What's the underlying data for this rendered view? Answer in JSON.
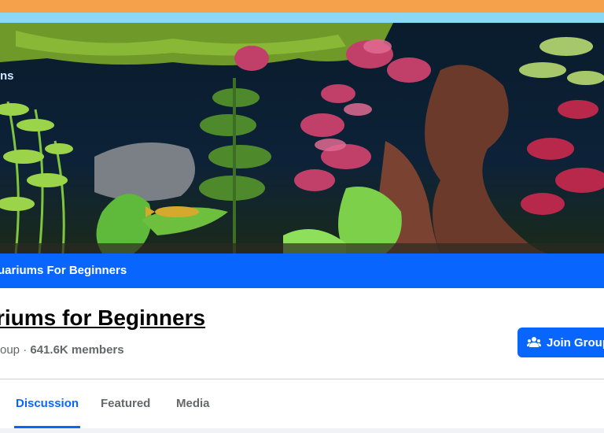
{
  "cover": {
    "logo_text": "ns"
  },
  "banner": {
    "group_name": "uariums For Beginners"
  },
  "group": {
    "title": "riums for Beginners",
    "privacy": "roup",
    "separator": " · ",
    "members": "641.6K members"
  },
  "join_button": {
    "label": "Join Group",
    "icon": "people-icon"
  },
  "tabs": [
    {
      "label": "Discussion",
      "active": true
    },
    {
      "label": "Featured",
      "active": false
    },
    {
      "label": "Media",
      "active": false
    }
  ],
  "colors": {
    "accent": "#0866ff",
    "top_bar_orange": "#f5a04a",
    "top_bar_blue": "#8ad8f4"
  }
}
